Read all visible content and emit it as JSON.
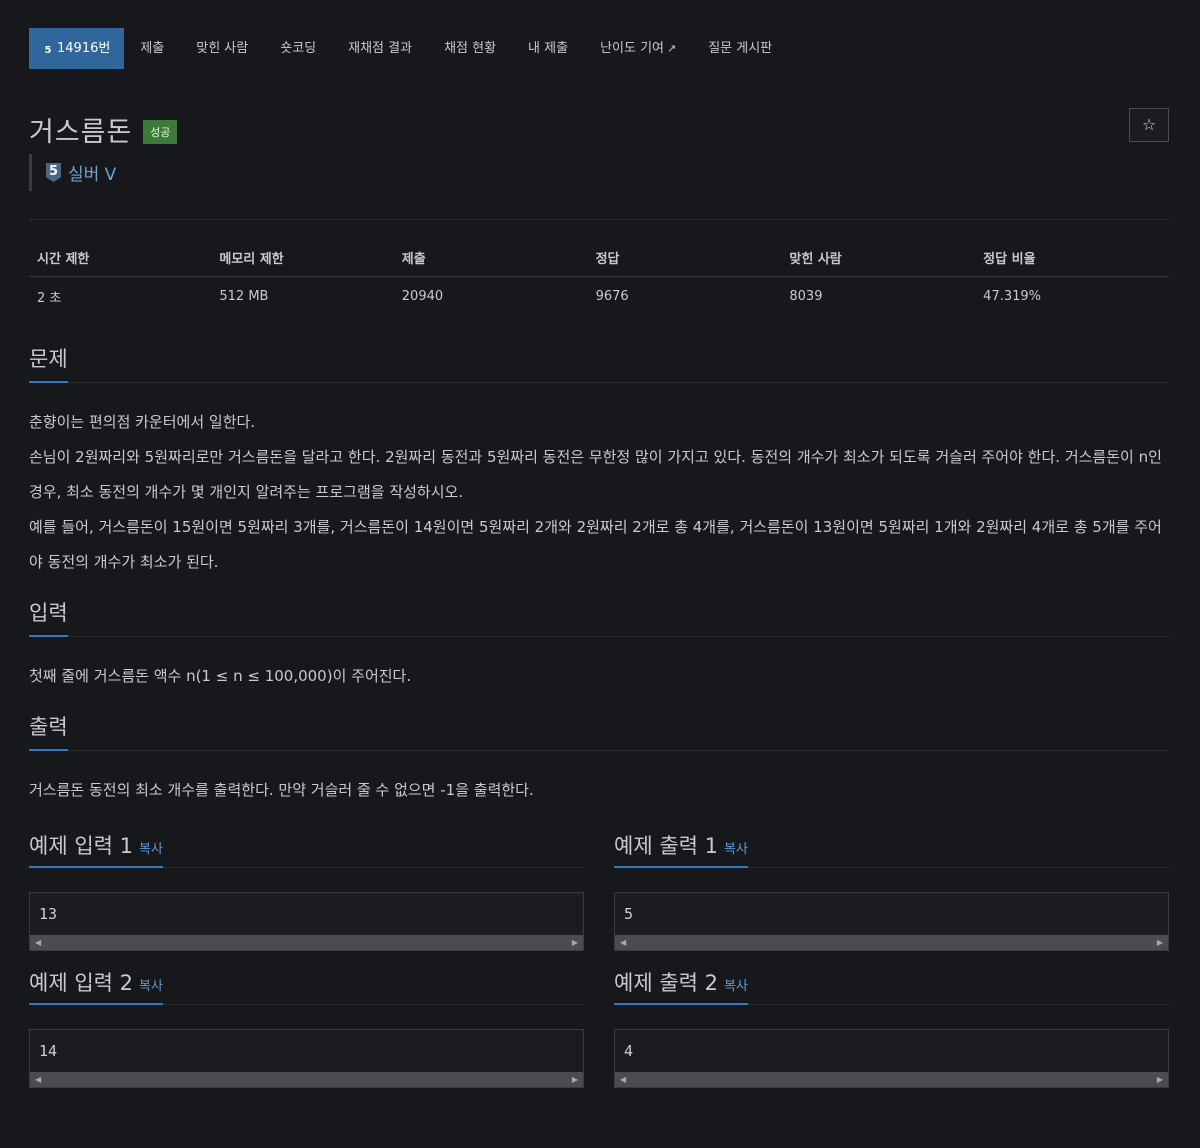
{
  "tabs": [
    {
      "label": "14916번",
      "tier_digit": "5",
      "active": true
    },
    {
      "label": "제출"
    },
    {
      "label": "맞힌 사람"
    },
    {
      "label": "숏코딩"
    },
    {
      "label": "재채점 결과"
    },
    {
      "label": "채점 현황"
    },
    {
      "label": "내 제출"
    },
    {
      "label": "난이도 기여",
      "external": true
    },
    {
      "label": "질문 게시판"
    }
  ],
  "problem": {
    "title": "거스름돈",
    "status_badge": "성공",
    "star_icon": "☆",
    "tier_digit": "5",
    "tier_label": "실버 V"
  },
  "info_table": {
    "headers": [
      "시간 제한",
      "메모리 제한",
      "제출",
      "정답",
      "맞힌 사람",
      "정답 비율"
    ],
    "values": [
      "2 초",
      "512 MB",
      "20940",
      "9676",
      "8039",
      "47.319%"
    ]
  },
  "sections": {
    "problem_heading": "문제",
    "problem_paragraphs": [
      "춘향이는 편의점 카운터에서 일한다.",
      "손님이 2원짜리와 5원짜리로만 거스름돈을 달라고 한다. 2원짜리 동전과 5원짜리 동전은 무한정 많이 가지고 있다. 동전의 개수가 최소가 되도록 거슬러 주어야 한다. 거스름돈이 n인 경우, 최소 동전의 개수가 몇 개인지 알려주는 프로그램을 작성하시오.",
      "예를 들어, 거스름돈이 15원이면 5원짜리 3개를, 거스름돈이 14원이면 5원짜리 2개와 2원짜리 2개로 총 4개를, 거스름돈이 13원이면 5원짜리 1개와 2원짜리 4개로 총 5개를 주어야 동전의 개수가 최소가 된다."
    ],
    "input_heading": "입력",
    "input_text": "첫째 줄에 거스름돈 액수 n(1 ≤ n ≤ 100,000)이 주어진다.",
    "output_heading": "출력",
    "output_text": "거스름돈 동전의 최소 개수를 출력한다. 만약 거슬러 줄 수 없으면 -1을 출력한다."
  },
  "samples": {
    "copy_label": "복사",
    "in1_title": "예제 입력 1",
    "in1_value": "13",
    "out1_title": "예제 출력 1",
    "out1_value": "5",
    "in2_title": "예제 입력 2",
    "in2_value": "14",
    "out2_title": "예제 출력 2",
    "out2_value": "4"
  },
  "colors": {
    "background": "#17181b",
    "active_tab": "#2f679c",
    "success_badge": "#3b7a37",
    "tier_text": "#6ea3d6",
    "section_underline": "#2f79c1"
  }
}
